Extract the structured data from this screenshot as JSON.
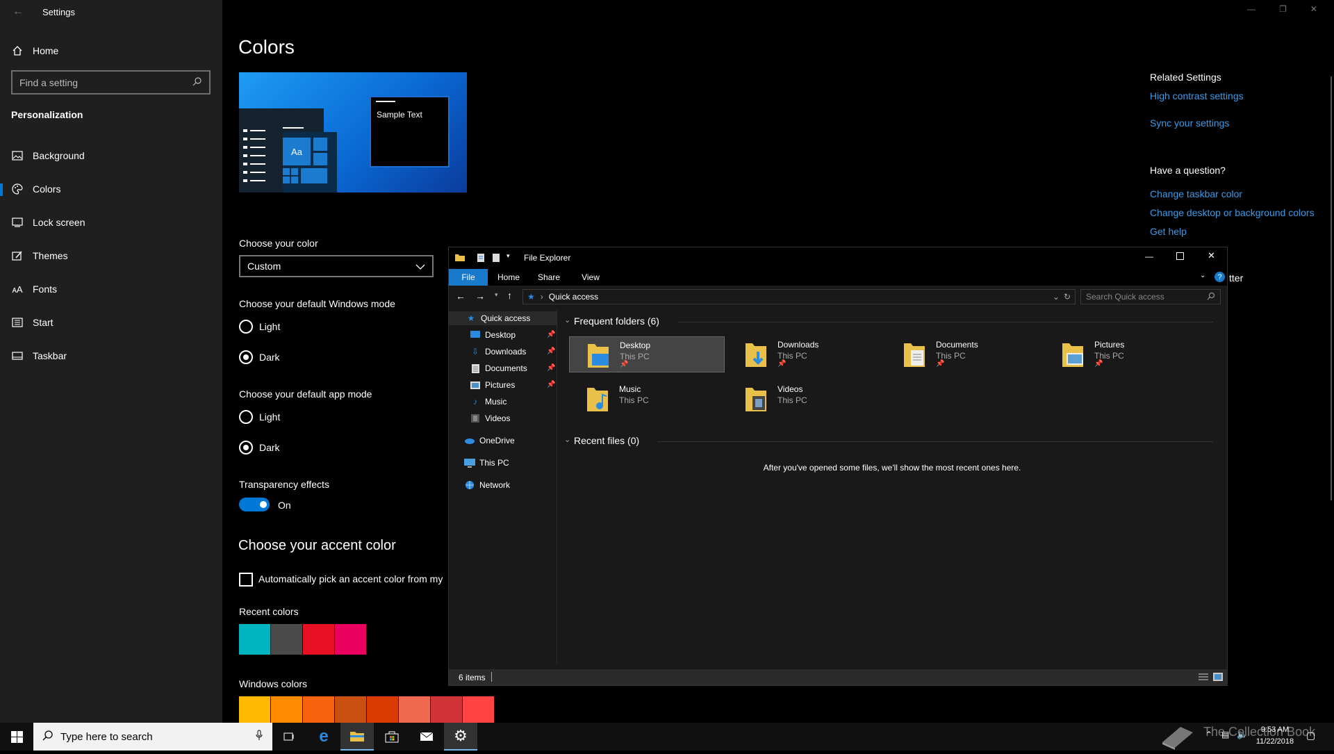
{
  "settings": {
    "app_title": "Settings",
    "home_label": "Home",
    "search_placeholder": "Find a setting",
    "section": "Personalization",
    "nav": [
      "Background",
      "Colors",
      "Lock screen",
      "Themes",
      "Fonts",
      "Start",
      "Taskbar"
    ],
    "active_nav": "Colors"
  },
  "main": {
    "title": "Colors",
    "preview_sample_text": "Sample Text",
    "preview_tile_text": "Aa",
    "choose_color_label": "Choose your color",
    "choose_color_value": "Custom",
    "windows_mode_label": "Choose your default Windows mode",
    "windows_mode_options": [
      "Light",
      "Dark"
    ],
    "windows_mode_selected": "Dark",
    "app_mode_label": "Choose your default app mode",
    "app_mode_options": [
      "Light",
      "Dark"
    ],
    "app_mode_selected": "Dark",
    "transparency_label": "Transparency effects",
    "transparency_state": "On",
    "accent_heading": "Choose your accent color",
    "auto_accent_label": "Automatically pick an accent color from my",
    "recent_colors_label": "Recent colors",
    "recent_colors": [
      "#00b4c0",
      "#4a4a4a",
      "#e81123",
      "#ea005e"
    ],
    "windows_colors_label": "Windows colors",
    "windows_colors": [
      "#ffb900",
      "#ff8c00",
      "#f7630c",
      "#ca5010",
      "#da3b01",
      "#ef6950",
      "#d13438",
      "#ff4343"
    ],
    "cut_off_text": "tter"
  },
  "related": {
    "heading": "Related Settings",
    "links": [
      "High contrast settings",
      "Sync your settings"
    ],
    "question_heading": "Have a question?",
    "question_links": [
      "Change taskbar color",
      "Change desktop or background colors",
      "Get help"
    ]
  },
  "explorer": {
    "title": "File Explorer",
    "tabs": [
      "File",
      "Home",
      "Share",
      "View"
    ],
    "address": "Quick access",
    "search_placeholder": "Search Quick access",
    "nav": {
      "quick_access": "Quick access",
      "pinned": [
        "Desktop",
        "Downloads",
        "Documents",
        "Pictures"
      ],
      "unpinned": [
        "Music",
        "Videos"
      ],
      "onedrive": "OneDrive",
      "this_pc": "This PC",
      "network": "Network"
    },
    "frequent_heading": "Frequent folders (6)",
    "folders": [
      {
        "name": "Desktop",
        "location": "This PC",
        "pinned": true,
        "selected": true
      },
      {
        "name": "Downloads",
        "location": "This PC",
        "pinned": true
      },
      {
        "name": "Documents",
        "location": "This PC",
        "pinned": true
      },
      {
        "name": "Pictures",
        "location": "This PC",
        "pinned": true
      },
      {
        "name": "Music",
        "location": "This PC",
        "pinned": false
      },
      {
        "name": "Videos",
        "location": "This PC",
        "pinned": false
      }
    ],
    "recent_heading": "Recent files (0)",
    "recent_empty": "After you've opened some files, we'll show the most recent ones here.",
    "status": "6 items"
  },
  "taskbar": {
    "search_placeholder": "Type here to search",
    "time": "9:53 AM",
    "date": "11/22/2018",
    "watermark": "The Collection Book"
  },
  "colors": {
    "accent": "#0078d7",
    "link": "#3d9ae8",
    "folder_yellow": "#e8c04a"
  }
}
